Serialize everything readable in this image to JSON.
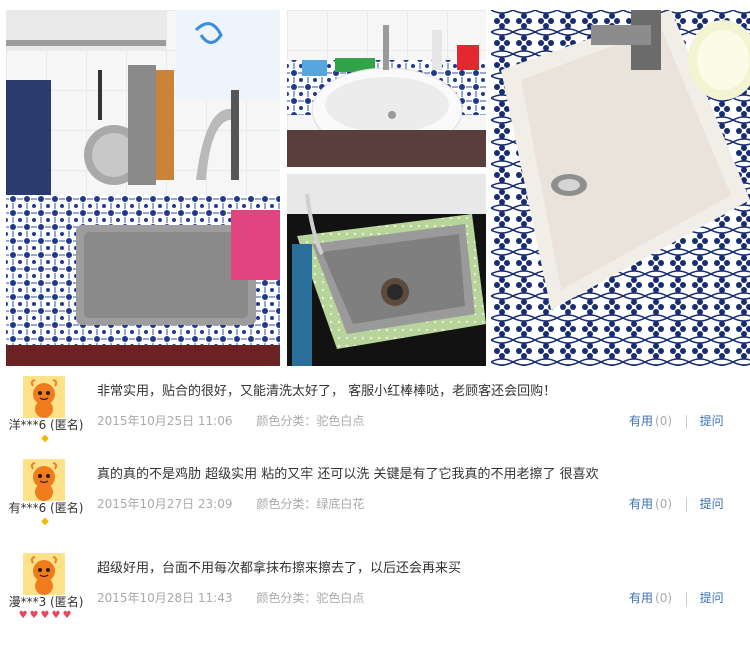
{
  "photos": [
    {
      "name": "photo-kitchen-sink-blue-tiles"
    },
    {
      "name": "photo-white-bathroom-basin"
    },
    {
      "name": "photo-stainless-sink-green-border"
    },
    {
      "name": "photo-basin-closeup-blue-pattern"
    }
  ],
  "reviews": [
    {
      "username": "洋***6 (匿名)",
      "badge_color": "yellow",
      "badge_count": 1,
      "content": "非常实用，贴合的很好，又能清洗太好了， 客服小红棒棒哒，老顾客还会回购！",
      "date": "2015年10月25日 11:06",
      "category": "颜色分类：驼色白点",
      "useful_label": "有用",
      "useful_count": "(0)",
      "reply_label": "提问"
    },
    {
      "username": "有***6 (匿名)",
      "badge_color": "yellow",
      "badge_count": 1,
      "content": "真的真的不是鸡肋 超级实用 粘的又牢 还可以洗 关键是有了它我真的不用老擦了 很喜欢",
      "date": "2015年10月27日 23:09",
      "category": "颜色分类：绿底白花",
      "useful_label": "有用",
      "useful_count": "(0)",
      "reply_label": "提问"
    },
    {
      "username": "漫***3 (匿名)",
      "badge_color": "red",
      "badge_count": 5,
      "content": "超级好用，台面不用每次都拿抹布擦来擦去了，以后还会再来买",
      "date": "2015年10月28日 11:43",
      "category": "颜色分类：驼色白点",
      "useful_label": "有用",
      "useful_count": "(0)",
      "reply_label": "提问"
    }
  ]
}
